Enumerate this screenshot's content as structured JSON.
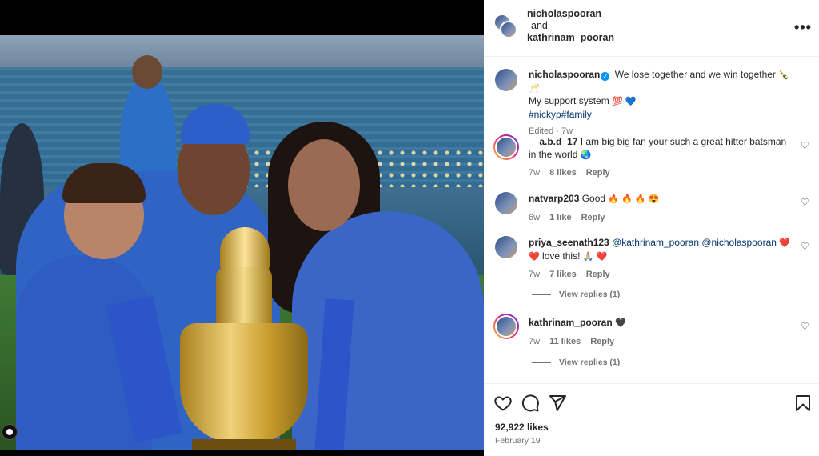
{
  "post": {
    "authors": [
      "nicholaspooran",
      "kathrinam_pooran"
    ],
    "and_text": "and",
    "caption": {
      "username": "nicholaspooran",
      "text_1": "We lose together and we win together",
      "emoji_1": "🍾🥂",
      "text_2": "My support system",
      "emoji_2": "💯 💙",
      "hashtags": "#nickyp#family",
      "edited": "Edited · 7w"
    },
    "likes": "92,922 likes",
    "date": "February 19"
  },
  "comments": [
    {
      "username": "__a.b.d_17",
      "text": "I am big big fan your such a great hitter batsman in the world",
      "emoji": "🌏",
      "time": "7w",
      "likes": "8 likes",
      "reply": "Reply"
    },
    {
      "username": "natvarp203",
      "text": "Good",
      "emoji": "🔥 🔥 🔥 😍",
      "time": "6w",
      "likes": "1 like",
      "reply": "Reply"
    },
    {
      "username": "priya_seenath123",
      "mention_1": "@kathrinam_pooran",
      "mention_2": "@nicholaspooran",
      "emoji_a": "❤️",
      "emoji_b": "❤️",
      "text": "love this!",
      "emoji_c": "🙏🏼 ❤️",
      "time": "7w",
      "likes": "7 likes",
      "reply": "Reply",
      "view_replies": "View replies (1)"
    },
    {
      "username": "kathrinam_pooran",
      "emoji": "🖤",
      "time": "7w",
      "likes": "11 likes",
      "reply": "Reply",
      "view_replies": "View replies (1)"
    }
  ],
  "icons": {
    "more": "more-icon",
    "heart": "heart-icon",
    "comment": "comment-icon",
    "share": "share-icon",
    "save": "bookmark-icon"
  },
  "colors": {
    "link": "#00376b",
    "verified": "#0095f6",
    "muted": "#737373"
  }
}
